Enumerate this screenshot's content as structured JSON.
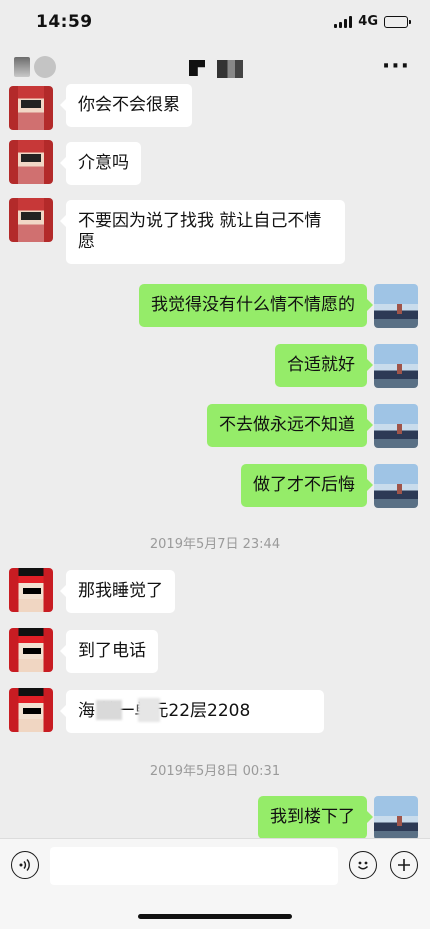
{
  "status_bar": {
    "time": "14:59",
    "network": "4G"
  },
  "nav": {
    "more_icon": "more-dots-icon"
  },
  "messages": [
    {
      "side": "in",
      "text": "你会不会很累"
    },
    {
      "side": "in",
      "text": "介意吗"
    },
    {
      "side": "in",
      "text": "不要因为说了找我 就让自己不情愿"
    },
    {
      "side": "out",
      "text": "我觉得没有什么情不情愿的"
    },
    {
      "side": "out",
      "text": "合适就好"
    },
    {
      "side": "out",
      "text": "不去做永远不知道"
    },
    {
      "side": "out",
      "text": "做了才不后悔"
    },
    {
      "side": "in",
      "text": "那我睡觉了"
    },
    {
      "side": "in",
      "text": "到了电话"
    },
    {
      "side": "in",
      "text": "海        楼一单元22层2208"
    },
    {
      "side": "out",
      "text": "我到楼下了"
    }
  ],
  "timestamps": [
    "2019年5月7日 23:44",
    "2019年5月8日 00:31"
  ],
  "input_bar": {
    "placeholder": "",
    "voice_icon": "voice-icon",
    "emoji_icon": "emoji-icon",
    "plus_icon": "plus-icon"
  },
  "colors": {
    "outgoing_bubble": "#95ec69",
    "incoming_bubble": "#ffffff",
    "background": "#ededed"
  }
}
